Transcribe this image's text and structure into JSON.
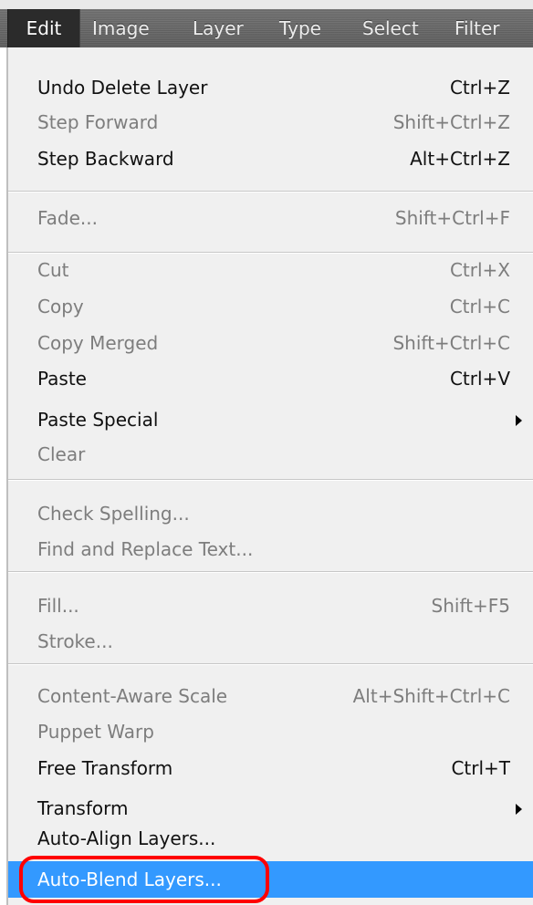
{
  "menubar": {
    "items": [
      "Edit",
      "Image",
      "Layer",
      "Type",
      "Select",
      "Filter"
    ]
  },
  "menu": {
    "items": [
      {
        "label": "Undo Delete Layer",
        "shortcut": "Ctrl+Z",
        "state": "enabled"
      },
      {
        "label": "Step Forward",
        "shortcut": "Shift+Ctrl+Z",
        "state": "disabled"
      },
      {
        "label": "Step Backward",
        "shortcut": "Alt+Ctrl+Z",
        "state": "enabled"
      },
      {
        "label": "Fade...",
        "shortcut": "Shift+Ctrl+F",
        "state": "disabled"
      },
      {
        "label": "Cut",
        "shortcut": "Ctrl+X",
        "state": "disabled"
      },
      {
        "label": "Copy",
        "shortcut": "Ctrl+C",
        "state": "disabled"
      },
      {
        "label": "Copy Merged",
        "shortcut": "Shift+Ctrl+C",
        "state": "disabled"
      },
      {
        "label": "Paste",
        "shortcut": "Ctrl+V",
        "state": "enabled"
      },
      {
        "label": "Paste Special",
        "shortcut": "",
        "state": "enabled",
        "submenu": true
      },
      {
        "label": "Clear",
        "shortcut": "",
        "state": "disabled"
      },
      {
        "label": "Check Spelling...",
        "shortcut": "",
        "state": "disabled"
      },
      {
        "label": "Find and Replace Text...",
        "shortcut": "",
        "state": "disabled"
      },
      {
        "label": "Fill...",
        "shortcut": "Shift+F5",
        "state": "disabled"
      },
      {
        "label": "Stroke...",
        "shortcut": "",
        "state": "disabled"
      },
      {
        "label": "Content-Aware Scale",
        "shortcut": "Alt+Shift+Ctrl+C",
        "state": "disabled"
      },
      {
        "label": "Puppet Warp",
        "shortcut": "",
        "state": "disabled"
      },
      {
        "label": "Free Transform",
        "shortcut": "Ctrl+T",
        "state": "enabled"
      },
      {
        "label": "Transform",
        "shortcut": "",
        "state": "enabled",
        "submenu": true
      },
      {
        "label": "Auto-Align Layers...",
        "shortcut": "",
        "state": "enabled"
      },
      {
        "label": "Auto-Blend Layers...",
        "shortcut": "",
        "state": "highlight"
      }
    ]
  },
  "colors": {
    "highlight": "#3399ff",
    "annotation": "#ff0000"
  }
}
